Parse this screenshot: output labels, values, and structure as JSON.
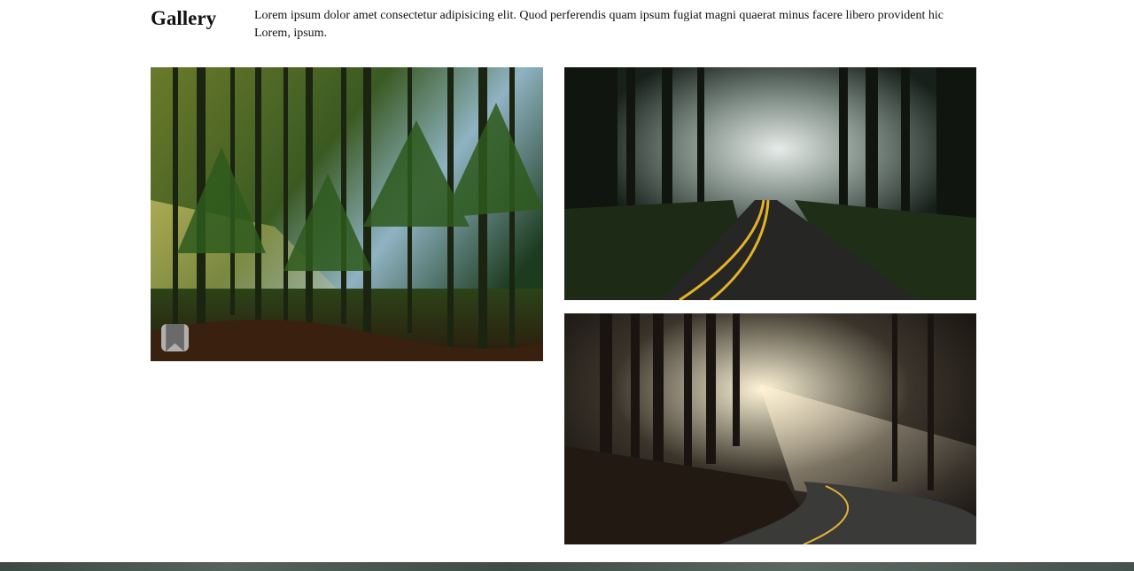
{
  "gallery": {
    "title": "Gallery",
    "description": "Lorem ipsum dolor amet consectetur adipisicing elit. Quod perferendis quam ipsum fugiat magni quaerat minus facere libero provident hic Lorem, ipsum."
  },
  "photos": [
    {
      "subject": "sunlit pine forest"
    },
    {
      "subject": "misty forest road with yellow lines"
    },
    {
      "subject": "winding road with sunbeams through trees"
    }
  ],
  "icons": {
    "bookmark": "bookmark-icon"
  }
}
